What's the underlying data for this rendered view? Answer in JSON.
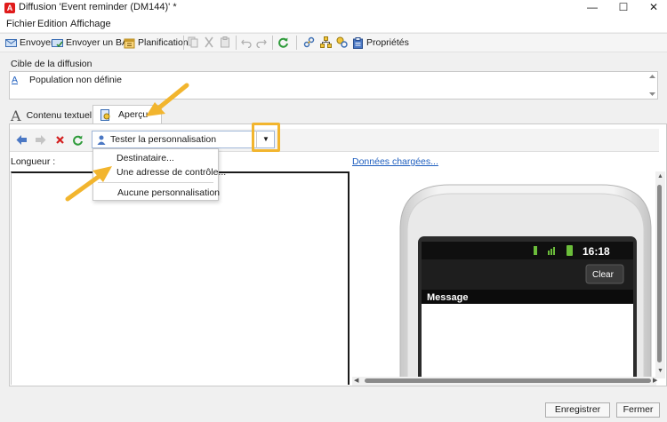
{
  "window": {
    "app_icon": "A",
    "title": "Diffusion 'Event reminder (DM144)' *",
    "minimize": "—",
    "maximize": "☐",
    "close": "✕"
  },
  "menu": [
    "Fichier",
    "Edition",
    "Affichage"
  ],
  "toolbar": {
    "send": "Envoyer",
    "send_bat": "Envoyer un BAT",
    "planning": "Planification",
    "properties": "Propriétés"
  },
  "cible": {
    "label": "Cible de la diffusion",
    "link": "A",
    "value": "Population non définie"
  },
  "tabs": {
    "text_glyph": "A",
    "text": "Contenu textuel",
    "preview": "Aperçu"
  },
  "personalization": {
    "combo_label": "Tester la personnalisation",
    "options": [
      "Destinataire...",
      "Une adresse de contrôle...",
      "Aucune personnalisation"
    ]
  },
  "panel": {
    "length_label": "Longueur :",
    "loaded_data": "Données chargées..."
  },
  "phone": {
    "time": "16:18",
    "clear_button": "Clear",
    "message_header": "Message"
  },
  "footer": {
    "save": "Enregistrer",
    "close": "Fermer"
  },
  "colors": {
    "highlight": "#f2b52e",
    "link": "#1f5fbf",
    "app_red": "#e01b1b"
  }
}
